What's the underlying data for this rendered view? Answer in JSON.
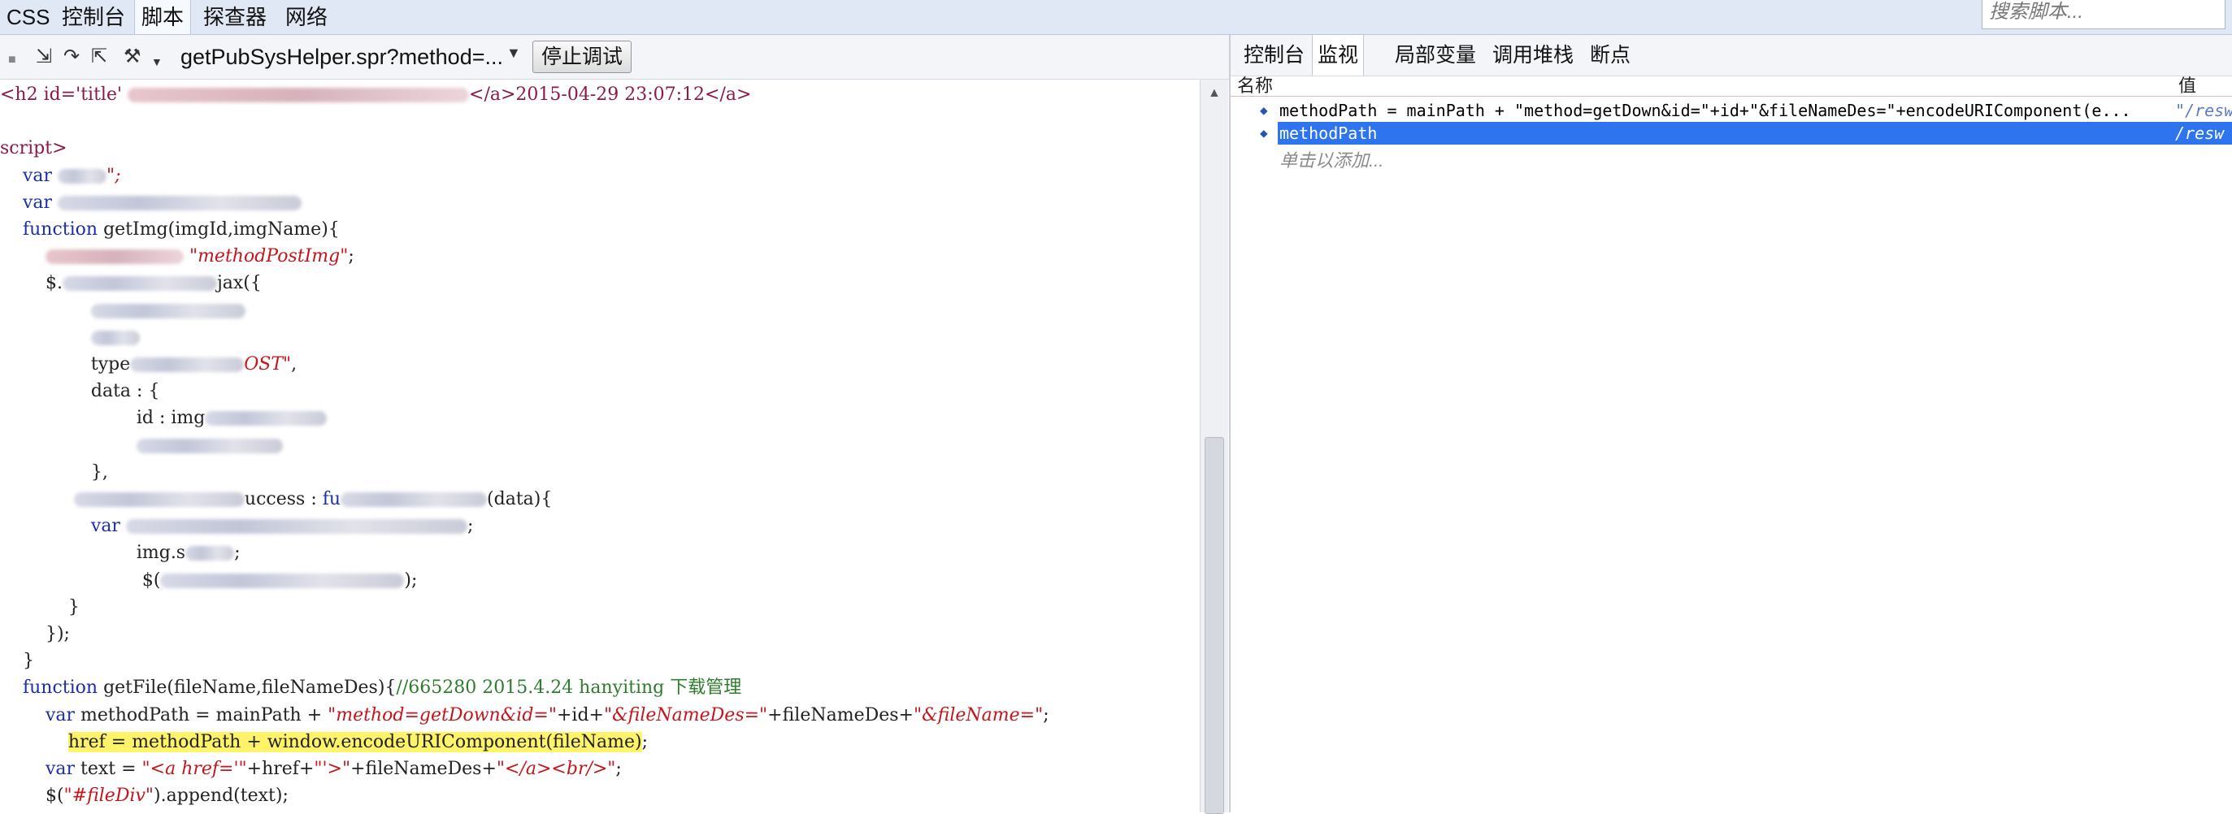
{
  "top_tabs": [
    "CSS",
    "控制台",
    "脚本",
    "探查器",
    "网络"
  ],
  "active_top_tab": "脚本",
  "search": {
    "placeholder": "搜索脚本..."
  },
  "toolbar": {
    "script_name": "getPubSysHelper.spr?method=...",
    "stop_debug_label": "停止调试"
  },
  "code_lines": [
    {
      "frag": [
        [
          "tag",
          "<h2 id='title' "
        ],
        [
          "blur",
          ""
        ],
        [
          "tag",
          "</a>2015-04-29 23:07:12</a>"
        ]
      ]
    },
    {
      "frag": []
    },
    {
      "frag": [
        [
          "tag",
          "script>"
        ]
      ]
    },
    {
      "frag": [
        [
          "kw",
          "    var "
        ],
        [
          "blur",
          ""
        ],
        [
          "str",
          "\";"
        ]
      ]
    },
    {
      "frag": [
        [
          "kw",
          "    var "
        ],
        [
          "blur",
          ""
        ]
      ]
    },
    {
      "frag": [
        [
          "kw",
          "    function "
        ],
        [
          "",
          "getImg(imgId,imgName){"
        ]
      ]
    },
    {
      "frag": [
        [
          "",
          "        "
        ],
        [
          "blur",
          ""
        ],
        [
          "str",
          " \"methodPostImg\""
        ],
        [
          "",
          ";"
        ]
      ]
    },
    {
      "frag": [
        [
          "",
          "        $."
        ],
        [
          "blur",
          ""
        ],
        [
          "",
          "jax({"
        ]
      ]
    },
    {
      "frag": [
        [
          "",
          "                "
        ],
        [
          "blur",
          ""
        ]
      ]
    },
    {
      "frag": [
        [
          "",
          "                "
        ],
        [
          "blur",
          ""
        ]
      ]
    },
    {
      "frag": [
        [
          "",
          "                type"
        ],
        [
          "blur",
          ""
        ],
        [
          "str",
          "OST\""
        ],
        [
          "",
          ","
        ]
      ]
    },
    {
      "frag": [
        [
          "",
          "                data : {"
        ]
      ]
    },
    {
      "frag": [
        [
          "",
          "                        id : img"
        ],
        [
          "blur",
          ""
        ]
      ]
    },
    {
      "frag": [
        [
          "",
          "                        "
        ],
        [
          "blur",
          ""
        ]
      ]
    },
    {
      "frag": [
        [
          "",
          "                },"
        ]
      ]
    },
    {
      "frag": [
        [
          "",
          "             "
        ],
        [
          "blur",
          ""
        ],
        [
          "",
          "uccess : "
        ],
        [
          "kw",
          "fu"
        ],
        [
          "blur",
          ""
        ],
        [
          "",
          "(data){"
        ]
      ]
    },
    {
      "frag": [
        [
          "kw",
          "                var "
        ],
        [
          "blur",
          ""
        ],
        [
          "",
          ";"
        ]
      ]
    },
    {
      "frag": [
        [
          "",
          "                        img.s"
        ],
        [
          "blur",
          ""
        ],
        [
          "",
          ";"
        ]
      ]
    },
    {
      "frag": [
        [
          "",
          "                         $("
        ],
        [
          "blur",
          ""
        ],
        [
          "",
          ");"
        ]
      ]
    },
    {
      "frag": [
        [
          "",
          "            }"
        ]
      ]
    },
    {
      "frag": [
        [
          "",
          "        });"
        ]
      ]
    },
    {
      "frag": [
        [
          "",
          "    }"
        ]
      ]
    },
    {
      "frag": [
        [
          "kw",
          "    function "
        ],
        [
          "",
          "getFile(fileName,fileNameDes){"
        ],
        [
          "cmt",
          "//665280 2015.4.24 hanyiting 下载管理"
        ]
      ]
    },
    {
      "frag": [
        [
          "kw",
          "        var "
        ],
        [
          "",
          "methodPath = mainPath + "
        ],
        [
          "str",
          "\"method=getDown&id=\""
        ],
        [
          "",
          "+id+"
        ],
        [
          "str",
          "\"&fileNameDes=\""
        ],
        [
          "",
          "+fileNameDes+"
        ],
        [
          "str",
          "\"&fileName=\""
        ],
        [
          "",
          ";"
        ]
      ]
    },
    {
      "frag": [
        [
          "",
          "            "
        ],
        [
          "hl",
          "href = methodPath + window.encodeURIComponent(fileName)"
        ],
        [
          "",
          ";"
        ]
      ]
    },
    {
      "frag": [
        [
          "kw",
          "        var "
        ],
        [
          "",
          "text = "
        ],
        [
          "str",
          "\"<a href='\""
        ],
        [
          "",
          "+href+"
        ],
        [
          "str",
          "\"'>\""
        ],
        [
          "",
          "+fileNameDes+"
        ],
        [
          "str",
          "\"</a><br/>\""
        ],
        [
          "",
          ";"
        ]
      ]
    },
    {
      "frag": [
        [
          "",
          "        $("
        ],
        [
          "str",
          "\"#fileDiv\""
        ],
        [
          "",
          ").append(text);"
        ]
      ]
    }
  ],
  "right_tabs": [
    "控制台",
    "监视",
    "局部变量",
    "调用堆栈",
    "断点"
  ],
  "active_right_tab": "监视",
  "watch": {
    "col_name": "名称",
    "col_value": "值",
    "rows": [
      {
        "expr": "methodPath = mainPath + \"method=getDown&id=\"+id+\"&fileNameDes=\"+encodeURIComponent(e...",
        "value": "\"/resw",
        "selected": false
      },
      {
        "expr": "methodPath",
        "value": "/resw",
        "selected": true
      }
    ],
    "add_hint": "单击以添加..."
  },
  "colors": {
    "keyword": "#1c2fa8",
    "string": "#c4161c",
    "comment": "#2d7d2d",
    "highlight": "#fff36a",
    "selection": "#2e74ee"
  }
}
